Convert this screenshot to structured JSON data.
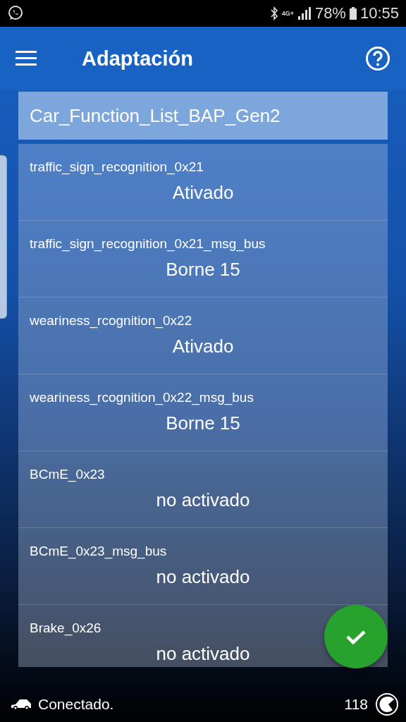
{
  "status_bar": {
    "battery": "78%",
    "time": "10:55",
    "network": "4G+"
  },
  "toolbar": {
    "title": "Adaptación"
  },
  "list": {
    "header": "Car_Function_List_BAP_Gen2",
    "items": [
      {
        "name": "traffic_sign_recognition_0x21",
        "value": "Ativado"
      },
      {
        "name": "traffic_sign_recognition_0x21_msg_bus",
        "value": "Borne 15"
      },
      {
        "name": "weariness_rcognition_0x22",
        "value": "Ativado"
      },
      {
        "name": "weariness_rcognition_0x22_msg_bus",
        "value": "Borne 15"
      },
      {
        "name": "BCmE_0x23",
        "value": "no activado"
      },
      {
        "name": "BCmE_0x23_msg_bus",
        "value": "no activado"
      },
      {
        "name": "Brake_0x26",
        "value": "no activado"
      }
    ]
  },
  "footer": {
    "status": "Conectado.",
    "count": "118"
  }
}
